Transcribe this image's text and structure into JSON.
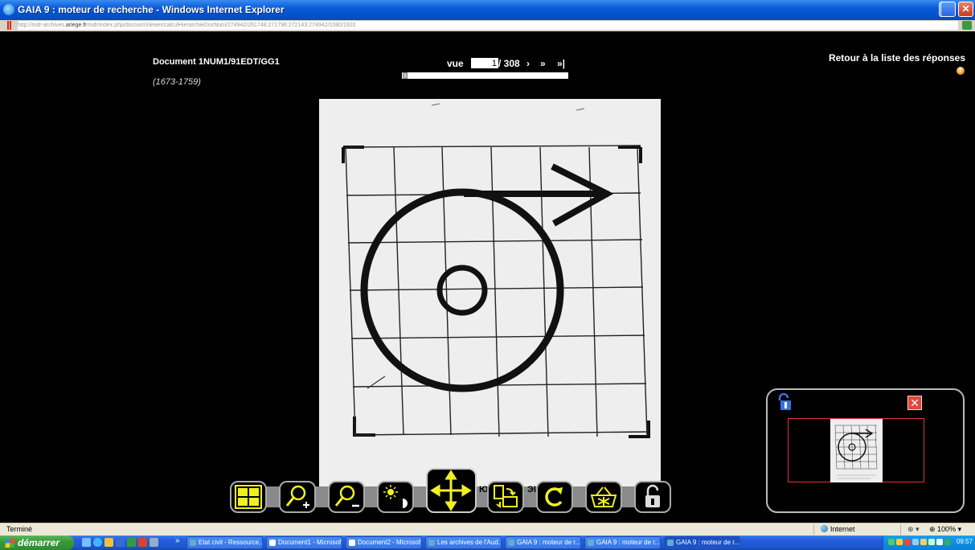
{
  "window": {
    "title": "GAIA 9 : moteur de recherche - Windows Internet Explorer",
    "url_prefix": "http://mdr-archives.",
    "url_domain": "ariege.fr",
    "url_rest": "/mdr/index.php/docnumViewer/calculHierarchieDocNum/274942/261748:271796:272143:274942/1080/1920"
  },
  "viewer": {
    "doc_title": "Document 1NUM1/91EDT/GG1",
    "doc_dates": "(1673-1759)",
    "vue_label": "vue",
    "page_value": "1",
    "page_total": "/ 308",
    "next": "›",
    "fast_forward": "»",
    "last": "»|",
    "page_position": 0.0,
    "back_link": "Retour à la liste des réponses",
    "help_glyph": "?"
  },
  "toolbar": {
    "buttons": [
      "grid-view",
      "zoom-in",
      "zoom-out",
      "brightness-contrast",
      "move",
      "rotate-left-mark",
      "swap-pages",
      "rotate-right-mark",
      "rotate",
      "basket",
      "lock"
    ],
    "icon_color": "#f0f020",
    "mark_left": "Ю",
    "mark_right": "ЭI"
  },
  "navigator": {
    "close_glyph": "✕",
    "frame_color": "#e0304a"
  },
  "statusbar": {
    "status": "Terminé",
    "zone": "Internet",
    "zoom": "100%",
    "protected": "⊕ ▾"
  },
  "taskbar": {
    "start": "démarrer",
    "tasks": [
      {
        "label": "Etat civil - Ressource...",
        "icon": "ie-icon"
      },
      {
        "label": "Document1 - Microsof...",
        "icon": "word-icon"
      },
      {
        "label": "Document2 - Microsof...",
        "icon": "word-icon"
      },
      {
        "label": "Les archives de l'Aud...",
        "icon": "ie-icon"
      },
      {
        "label": "GAIA 9 : moteur de r...",
        "icon": "ie-icon"
      },
      {
        "label": "GAIA 9 : moteur de r...",
        "icon": "ie-icon"
      },
      {
        "label": "GAIA 9 : moteur de r...",
        "icon": "ie-icon"
      }
    ],
    "clock": "09:57",
    "chevron": "»"
  }
}
